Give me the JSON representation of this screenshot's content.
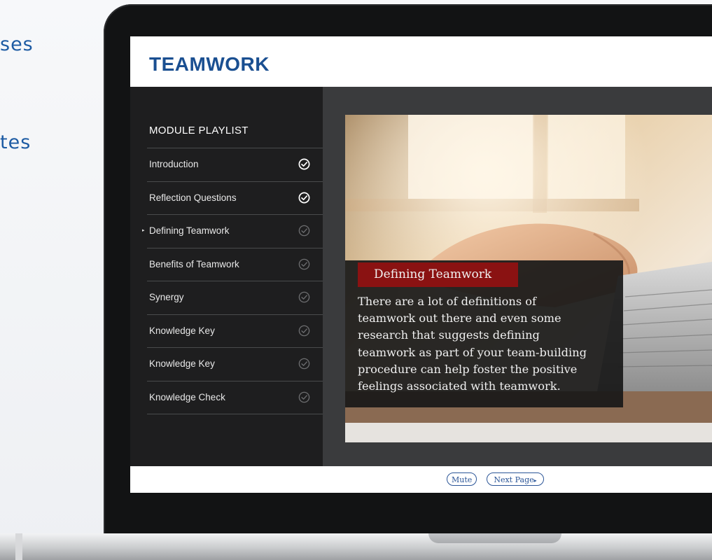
{
  "background_text": {
    "line_a": "ses",
    "line_b": "tes"
  },
  "app": {
    "title": "TEAMWORK"
  },
  "playlist": {
    "heading": "MODULE PLAYLIST",
    "items": [
      {
        "label": "Introduction",
        "status": "complete",
        "current": false
      },
      {
        "label": "Reflection Questions",
        "status": "complete",
        "current": false
      },
      {
        "label": "Defining Teamwork",
        "status": "incomplete",
        "current": true
      },
      {
        "label": "Benefits of Teamwork",
        "status": "incomplete",
        "current": false
      },
      {
        "label": "Synergy",
        "status": "incomplete",
        "current": false
      },
      {
        "label": "Knowledge Key",
        "status": "incomplete",
        "current": false
      },
      {
        "label": "Knowledge Key",
        "status": "incomplete",
        "current": false
      },
      {
        "label": "Knowledge Check",
        "status": "incomplete",
        "current": false
      }
    ],
    "current_marker": "▸"
  },
  "slide": {
    "caption_title": "Defining Teamwork",
    "caption_lines": [
      "There are a lot of definitions of",
      "teamwork out there and even some",
      "research that suggests defining",
      "teamwork as part of your team-building",
      "procedure can help foster the positive",
      "feelings associated with teamwork."
    ],
    "search_icon": "search-icon"
  },
  "controls": {
    "mute_label": "Mute",
    "next_label": "Next Page",
    "next_arrow": "▸"
  },
  "colors": {
    "brand_blue": "#1a4f91",
    "caption_red": "#8a1212",
    "sidebar_bg": "#1e1e1f",
    "content_bg": "#3a3b3d",
    "check_complete": "#ffffff",
    "check_incomplete": "#6d6e70"
  }
}
